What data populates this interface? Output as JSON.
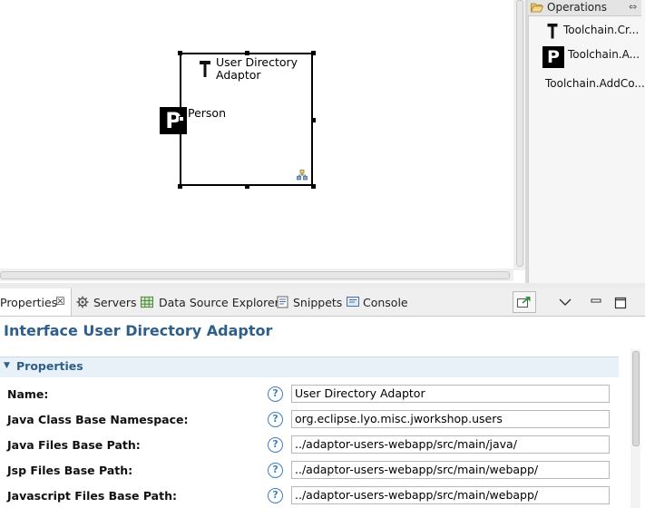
{
  "diagram": {
    "node_title": "User Directory\nAdaptor",
    "port_glyph": "P",
    "port_label": "Person"
  },
  "palette": {
    "header": "Operations",
    "items": [
      {
        "label": "Toolchain.Cr...",
        "icon": "hammer-icon"
      },
      {
        "label": "Toolchain.A...",
        "icon": "p-badge-icon",
        "glyph": "P"
      },
      {
        "label": "Toolchain.AddCo...",
        "icon": ""
      }
    ]
  },
  "tabs": [
    {
      "label": "Properties",
      "icon": "properties-icon",
      "active": true
    },
    {
      "label": "Servers",
      "icon": "servers-icon"
    },
    {
      "label": "Data Source Explorer",
      "icon": "data-source-explorer-icon"
    },
    {
      "label": "Snippets",
      "icon": "snippets-icon"
    },
    {
      "label": "Console",
      "icon": "console-icon"
    }
  ],
  "properties": {
    "title": "Interface User Directory Adaptor",
    "section": "Properties",
    "help_glyph": "?",
    "fields": [
      {
        "label": "Name:",
        "value": "User Directory Adaptor"
      },
      {
        "label": "Java Class Base Namespace:",
        "value": "org.eclipse.lyo.misc.jworkshop.users"
      },
      {
        "label": "Java Files Base Path:",
        "value": "../adaptor-users-webapp/src/main/java/"
      },
      {
        "label": "Jsp Files Base Path:",
        "value": "../adaptor-users-webapp/src/main/webapp/"
      },
      {
        "label": "Javascript Files Base Path:",
        "value": "../adaptor-users-webapp/src/main/webapp/"
      }
    ]
  },
  "colors": {
    "accent": "#2e5e8a",
    "section_bg": "#e9f1f8",
    "help": "#3c7fc1"
  }
}
